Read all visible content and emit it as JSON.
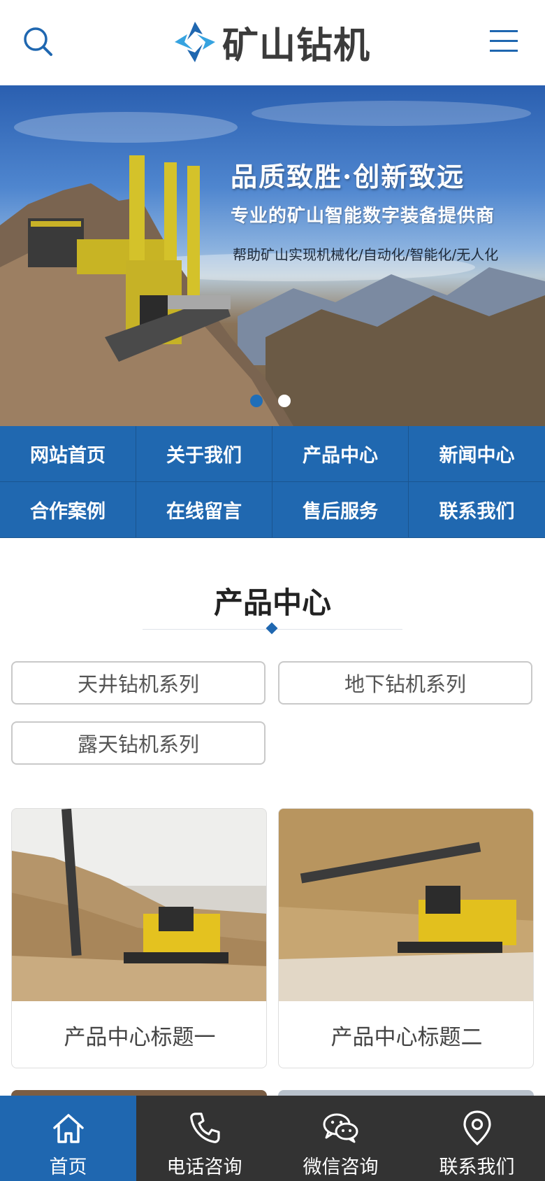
{
  "header": {
    "logo_text": "矿山钻机",
    "search_icon": "search-icon",
    "menu_icon": "menu-icon"
  },
  "banner": {
    "title": "品质致胜·创新致远",
    "subtitle": "专业的矿山智能数字装备提供商",
    "description": "帮助矿山实现机械化/自动化/智能化/无人化",
    "slides": 2,
    "active_slide": 1
  },
  "nav": {
    "items": [
      {
        "label": "网站首页"
      },
      {
        "label": "关于我们"
      },
      {
        "label": "产品中心"
      },
      {
        "label": "新闻中心"
      },
      {
        "label": "合作案例"
      },
      {
        "label": "在线留言"
      },
      {
        "label": "售后服务"
      },
      {
        "label": "联系我们"
      }
    ]
  },
  "products": {
    "section_title": "产品中心",
    "categories": [
      {
        "label": "天井钻机系列"
      },
      {
        "label": "地下钻机系列"
      },
      {
        "label": "露天钻机系列"
      }
    ],
    "cards": [
      {
        "title": "产品中心标题一"
      },
      {
        "title": "产品中心标题二"
      }
    ]
  },
  "footer": {
    "items": [
      {
        "label": "首页",
        "icon": "home-icon"
      },
      {
        "label": "电话咨询",
        "icon": "phone-icon"
      },
      {
        "label": "微信咨询",
        "icon": "wechat-icon"
      },
      {
        "label": "联系我们",
        "icon": "location-pin-icon"
      }
    ]
  },
  "colors": {
    "primary": "#1f67b0",
    "footer_bg": "#333333",
    "text_dark": "#222222"
  }
}
